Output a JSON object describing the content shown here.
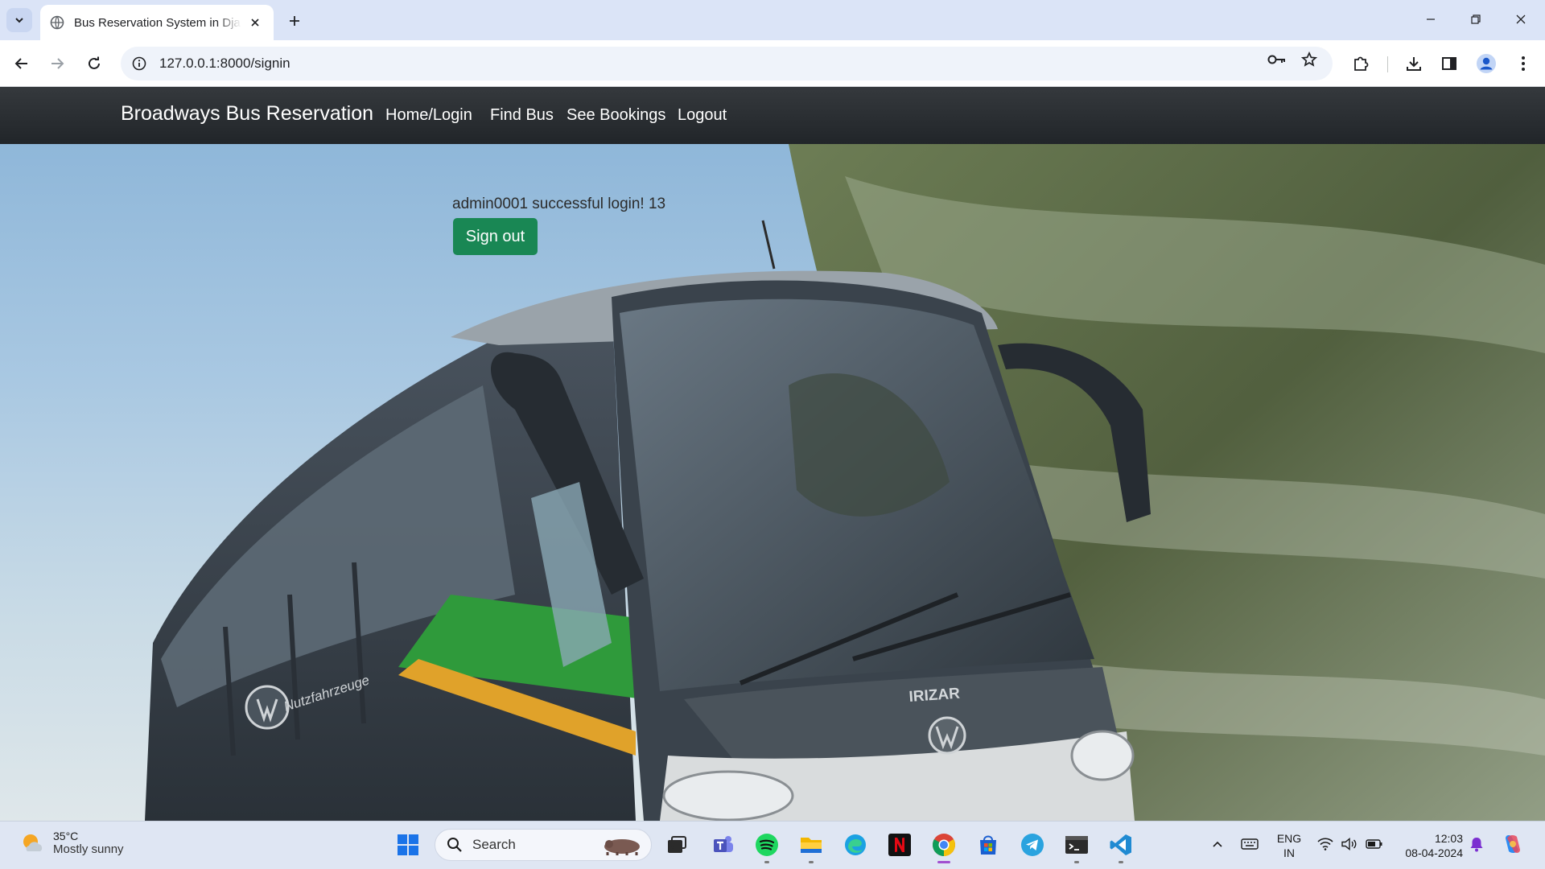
{
  "browser": {
    "tab_title": "Bus Reservation System in Django",
    "url": "127.0.0.1:8000/signin"
  },
  "navbar": {
    "brand": "Broadways Bus Reservation",
    "links": [
      "Home/Login",
      "Find Bus",
      "See Bookings",
      "Logout"
    ]
  },
  "main": {
    "login_message": "admin0001 successful login! 13",
    "signout_label": "Sign out"
  },
  "hero_image": {
    "bus_brand_text": "IRIZAR",
    "side_text": "Nutzfahrzeuge"
  },
  "taskbar": {
    "weather_temp": "35°C",
    "weather_desc": "Mostly sunny",
    "search_label": "Search",
    "lang_line1": "ENG",
    "lang_line2": "IN",
    "time": "12:03",
    "date": "08-04-2024"
  },
  "colors": {
    "navbar": "#212529",
    "signout_button": "#198754",
    "tab_strip": "#dbe4f7"
  }
}
